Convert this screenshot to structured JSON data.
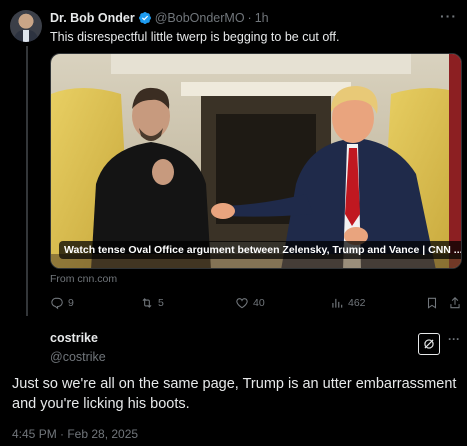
{
  "tweet": {
    "author_name": "Dr. Bob Onder",
    "author_handle": "@BobOnderMO",
    "separator": "·",
    "time": "1h",
    "text": "This disrespectful little twerp is begging to be cut off.",
    "media_caption": "Watch tense Oval Office argument between Zelensky, Trump and Vance | CNN ...",
    "source": "From cnn.com",
    "stats": {
      "replies": "9",
      "retweets": "5",
      "likes": "40",
      "views": "462"
    },
    "icons": [
      "verified-badge-icon",
      "more-icon",
      "reply-icon",
      "retweet-icon",
      "like-icon",
      "views-icon",
      "bookmark-icon",
      "share-icon"
    ]
  },
  "reply": {
    "author_name": "costrike",
    "author_handle": "@costrike",
    "text": "Just so we're all on the same page, Trump is an utter embarrassment and you're licking his boots.",
    "timestamp": "4:45 PM · Feb 28, 2025",
    "icons": [
      "grok-logo-icon",
      "more-icon"
    ]
  },
  "colors": {
    "background": "#000000",
    "text": "#e7e9ea",
    "muted": "#71767b",
    "verified": "#1d9bf0",
    "divider": "#2f3336"
  }
}
